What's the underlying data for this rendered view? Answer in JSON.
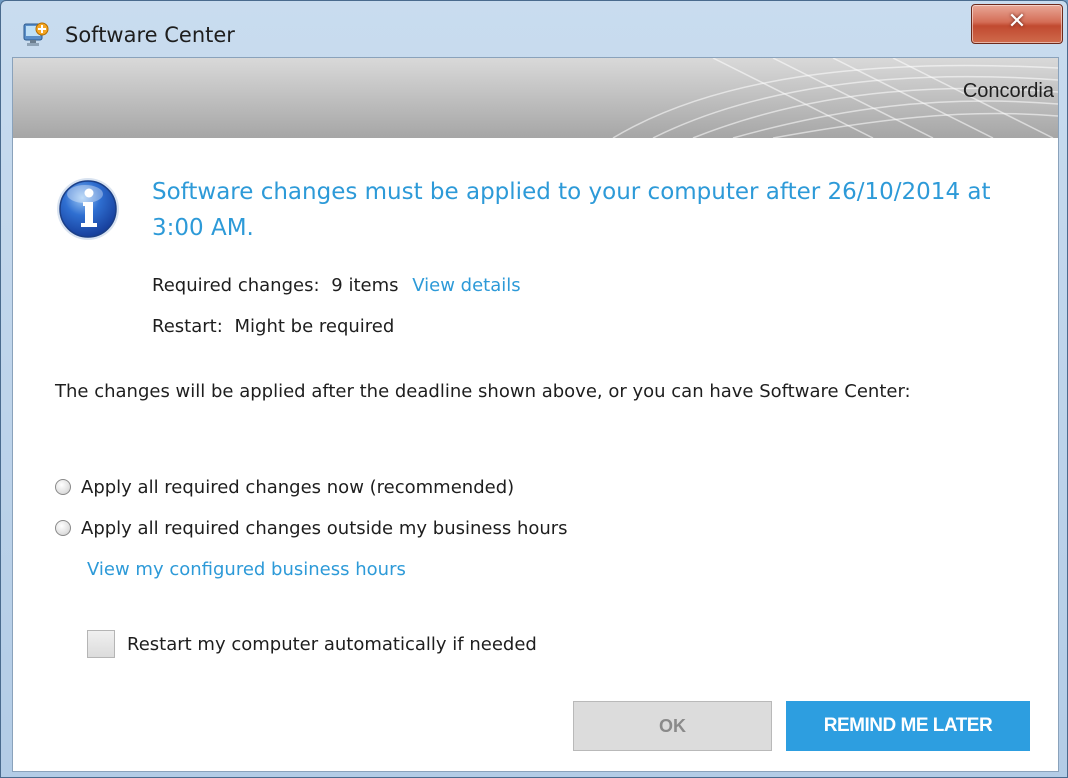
{
  "window": {
    "title": "Software Center",
    "close_glyph": "✕"
  },
  "banner": {
    "organization": "Concordia"
  },
  "notice": {
    "headline": "Software changes must be applied to your computer after 26/10/2014 at 3:00 AM.",
    "required_label": "Required changes:",
    "required_value": "9 items",
    "view_details_link": "View details",
    "restart_label": "Restart:",
    "restart_value": "Might be required"
  },
  "body": {
    "paragraph": "The changes will be applied after the deadline shown above, or you can have Software Center:"
  },
  "options": {
    "apply_now": "Apply all required changes now (recommended)",
    "apply_outside_hours": "Apply all required changes outside my business hours",
    "business_hours_link": "View my configured business hours",
    "restart_checkbox": "Restart my computer automatically if needed"
  },
  "buttons": {
    "ok": "OK",
    "remind_later": "REMIND ME LATER"
  },
  "icons": {
    "app": "software-center-icon",
    "info": "info-icon",
    "close": "close-icon"
  },
  "colors": {
    "accent": "#2d9ad8",
    "button_primary": "#2d9ee0",
    "button_disabled": "#dcdcdc"
  }
}
